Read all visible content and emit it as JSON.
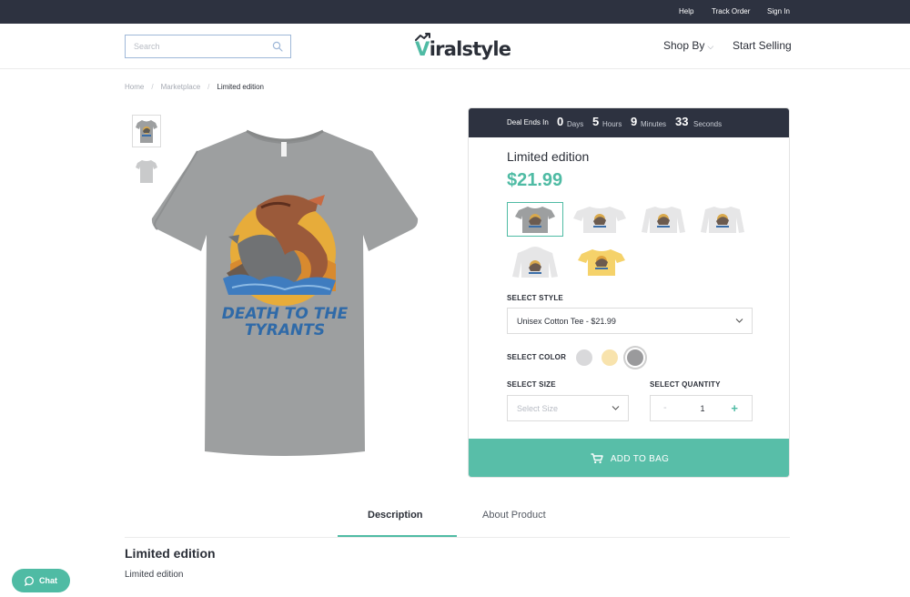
{
  "topbar": {
    "links": [
      "Help",
      "Track Order",
      "Sign In"
    ]
  },
  "header": {
    "search_placeholder": "Search",
    "logo": {
      "first": "V",
      "rest": "iralstyle"
    },
    "nav": {
      "shop_by": "Shop By",
      "start_selling": "Start Selling"
    }
  },
  "breadcrumb": [
    "Home",
    "Marketplace",
    "Limited edition"
  ],
  "countdown": {
    "label": "Deal Ends In",
    "days": "0",
    "days_unit": "Days",
    "hours": "5",
    "hours_unit": "Hours",
    "minutes": "9",
    "minutes_unit": "Minutes",
    "seconds": "33",
    "seconds_unit": "Seconds"
  },
  "product": {
    "title": "Limited edition",
    "price": "$21.99",
    "shirt_text_line1": "DEATH TO THE",
    "shirt_text_line2": "TYRANTS"
  },
  "options": {
    "style_label": "SELECT STYLE",
    "style_value": "Unisex Cotton Tee - $21.99",
    "color_label": "SELECT COLOR",
    "colors": [
      "#d9d9db",
      "#f8e3ad",
      "#9a9a9c"
    ],
    "selected_color_index": 2,
    "size_label": "SELECT SIZE",
    "size_placeholder": "Select Size",
    "quantity_label": "SELECT QUANTITY",
    "quantity_minus": "-",
    "quantity": "1",
    "quantity_plus": "+"
  },
  "add_to_bag": "ADD TO BAG",
  "tabs": {
    "description": "Description",
    "about": "About Product"
  },
  "description": {
    "title": "Limited edition",
    "body": "Limited edition"
  },
  "chat": "Chat",
  "colors": {
    "accent": "#4fbba4",
    "dark": "#2d3240",
    "heather_grey": "#9d9fa0"
  }
}
